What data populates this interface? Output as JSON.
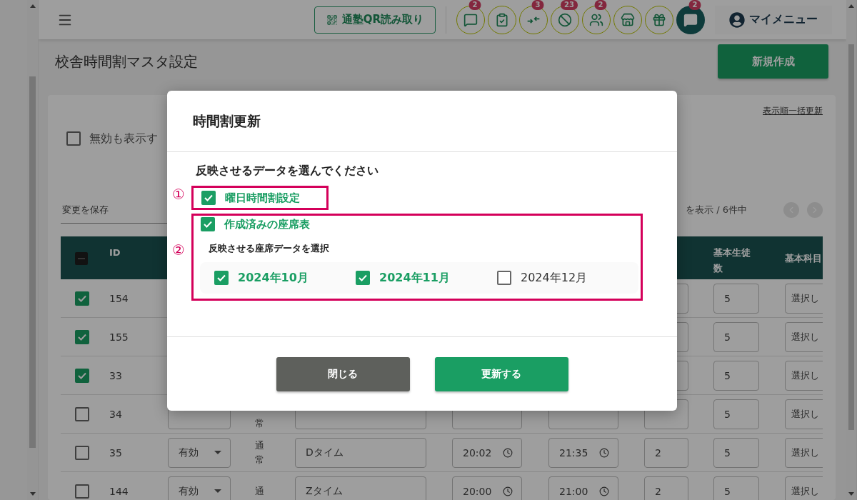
{
  "header": {
    "qr_button": "通塾QR読み取り",
    "icons": [
      {
        "kind": "chat",
        "badge": "2"
      },
      {
        "kind": "checklist"
      },
      {
        "kind": "arrows",
        "badge": "3"
      },
      {
        "kind": "blocked",
        "badge": "23"
      },
      {
        "kind": "group",
        "badge": "2"
      },
      {
        "kind": "store"
      },
      {
        "kind": "gift"
      },
      {
        "kind": "chat-filled",
        "badge": "2"
      }
    ],
    "my_menu": "マイメニュー"
  },
  "page_title": "校舎時間割マスタ設定",
  "new_button": "新規作成",
  "card": {
    "bulk_link": "表示順一括更新",
    "show_inactive": {
      "label": "無効も表示す",
      "checked": false
    },
    "save_field": {
      "placeholder": "変更を保存"
    },
    "pagination_text": "を表示 / 6件中"
  },
  "table": {
    "header_checkbox": {
      "indeterminate": true
    },
    "columns": {
      "id": "ID",
      "students": "基本生徒数",
      "subject": "基本科目"
    },
    "rows": [
      {
        "id": "154",
        "checked": true,
        "covered": true,
        "students": "5",
        "subject": "選択し"
      },
      {
        "id": "155",
        "checked": true,
        "covered": true,
        "students": "5",
        "subject": "選択し"
      },
      {
        "id": "33",
        "checked": true,
        "covered": true,
        "students": "5",
        "subject": "選択し"
      },
      {
        "id": "34",
        "checked": false,
        "covered": false,
        "type": "常",
        "students": "5",
        "subject": "選択し"
      },
      {
        "id": "35",
        "checked": false,
        "covered": false,
        "status": "有効",
        "type": "通常",
        "name": "Dタイム",
        "start": "20:02",
        "end": "21:35",
        "count": "2",
        "students": "5",
        "subject": "選択し"
      },
      {
        "id": "144",
        "checked": false,
        "covered": false,
        "status": "有効",
        "type": "通",
        "name": "Zタイム",
        "start": "20:00",
        "end": "21:00",
        "count": "2",
        "students": "5",
        "subject": "選択し"
      }
    ]
  },
  "dialog": {
    "title": "時間割更新",
    "prompt": "反映させるデータを選んでください",
    "option_1": {
      "marker": "①",
      "label": "曜日時間割設定",
      "checked": true
    },
    "option_2": {
      "marker": "②",
      "label": "作成済みの座席表",
      "checked": true,
      "sub_label": "反映させる座席データを選択",
      "months": [
        {
          "label": "2024年10月",
          "checked": true
        },
        {
          "label": "2024年11月",
          "checked": true
        },
        {
          "label": "2024年12月",
          "checked": false
        }
      ]
    },
    "buttons": {
      "close": "閉じる",
      "update": "更新する"
    }
  }
}
